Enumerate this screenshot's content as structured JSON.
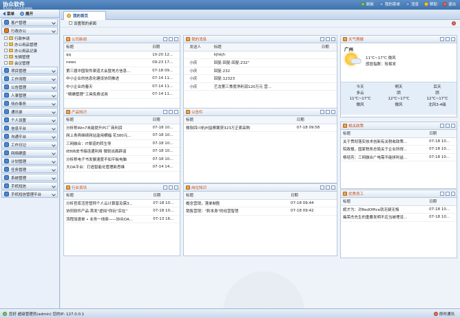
{
  "app": {
    "title": "协众软件",
    "subtitle": "专业OA 为企业提速增效"
  },
  "top_links": [
    "刷新",
    "我的菜单",
    "消息",
    "帮助",
    "退出"
  ],
  "sidebar": {
    "head": [
      "菜单",
      "展开"
    ],
    "menus": [
      {
        "label": "客户管理",
        "open": false
      },
      {
        "label": "行政办公",
        "open": true,
        "sub": [
          "行政申请",
          "办公用品管理",
          "办公用品记录",
          "车辆管理",
          "会议管理"
        ]
      },
      {
        "label": "项目管理"
      },
      {
        "label": "工作流程"
      },
      {
        "label": "公告管理"
      },
      {
        "label": "人事管理"
      },
      {
        "label": "待办事务"
      },
      {
        "label": "通讯录"
      },
      {
        "label": "个人设置"
      },
      {
        "label": "信息平台"
      },
      {
        "label": "沟通平台"
      },
      {
        "label": "工作日记"
      },
      {
        "label": "网络硬盘"
      },
      {
        "label": "计划管理"
      },
      {
        "label": "任务管理"
      },
      {
        "label": "系统管理"
      },
      {
        "label": "手机短信"
      },
      {
        "label": "手机短信管理平台"
      }
    ]
  },
  "main": {
    "tab": "我的首页",
    "toolbar_label": "设置我的桌面"
  },
  "panels": {
    "company_news": {
      "title": "公司新闻",
      "cols": [
        "标题",
        "日期"
      ],
      "rows": [
        [
          "qq",
          "10-20 12..."
        ],
        [
          "news",
          "09-23 17..."
        ],
        [
          "第三届中国软件渠道大会暨地方信息...",
          "07-18 09..."
        ],
        [
          "中小企业的信息化建设协同推进",
          "07-14 11..."
        ],
        [
          "中小企业的春天",
          "07-14 11..."
        ],
        [
          "“精确管理”工具免费试用",
          "07-14 11..."
        ]
      ]
    },
    "my_messages": {
      "title": "我的消息",
      "cols": [
        "",
        "发送人",
        "标题",
        "日期"
      ],
      "rows": [
        [
          "",
          "",
          "kjhkjh",
          ""
        ],
        [
          "",
          "小庆",
          "回复:回复:回复:232\"",
          ""
        ],
        [
          "",
          "小庆",
          "回复:232",
          ""
        ],
        [
          "",
          "小庆",
          "回复:12323",
          ""
        ],
        [
          "",
          "小庆",
          "艺龙第三季度净利润120万元 营...",
          ""
        ]
      ]
    },
    "product_knowledge": {
      "title": "产品知识",
      "cols": [
        "标题",
        "日期"
      ],
      "rows": [
        [
          "分析称Win7未能提升PC厂商利润",
          "07-18 10..."
        ],
        [
          "网上贵宾继续网站滥用横幅 花380元...",
          "07-18 10..."
        ],
        [
          "三网融合：IT渠道的转生导",
          "07-18 10..."
        ],
        [
          "IE8自皮书接连遭利用 微软出面辟谣",
          "07-18 10..."
        ],
        [
          "分析称电子书发展速度不如平板电脑",
          "07-18 10..."
        ],
        [
          "大OA平台：打造智能化管理新思维",
          "07-14 14..."
        ]
      ]
    },
    "bulletin": {
      "title": "公告栏",
      "cols": [
        "标题",
        "日期"
      ],
      "rows": [
        [
          "微软四川杭州监察案获323万正索采购",
          "07-18 09:58"
        ]
      ]
    },
    "industry_news": {
      "title": "行业资讯",
      "cols": [
        "标题",
        "日期"
      ],
      "rows": [
        [
          "分析官库活官管称个人云计算普及需3...",
          "07-18 10..."
        ],
        [
          "协同软件产品 首发\"虚拟\"你玩\"实在\"",
          "07-18 10..."
        ],
        [
          "流程加速单 • 业务一线牵——协众OA...",
          "07-13 16..."
        ]
      ]
    },
    "sales_knowledge": {
      "title": "岗位知识",
      "cols": [
        "标题",
        "日期"
      ],
      "rows": [
        [
          "概念营销，落单制胜",
          "07-18 09:44"
        ],
        [
          "销售营销：\"刺本身\"的经营智慧",
          "07-18 09:42"
        ]
      ]
    },
    "weather": {
      "title": "天气预报",
      "city": "广州",
      "temp": "11℃~17℃",
      "wind": "微风",
      "comfort": "感冒指数：较易发",
      "days": [
        {
          "name": "今天",
          "cond": "多云",
          "temp": "11℃~17℃",
          "wind": "微风"
        },
        {
          "name": "明天",
          "cond": "阴",
          "temp": "12℃~17℃",
          "wind": "微风"
        },
        {
          "name": "后天",
          "cond": "阴",
          "temp": "12℃~17℃",
          "wind": "北风3-4级"
        }
      ]
    },
    "policy": {
      "title": "相关政策",
      "cols": [
        "标题",
        "日期"
      ],
      "rows": [
        [
          "关于贯彻落实技术创新有关税收政策...",
          "07-18 10..."
        ],
        [
          "院政报，国家税务总局关于企业所得...",
          "07-18 10..."
        ],
        [
          "杨培芳：三网融合广电需不能拼利益...",
          "07-18 10..."
        ]
      ]
    },
    "staff": {
      "title": "优秀员工",
      "cols": [
        "标题",
        "日期"
      ],
      "rows": [
        [
          "妮才为：对RedOffice就无疑无悔",
          "07-18 10..."
        ],
        [
          "雍荣杰先生的重要发明不应当被埋没...",
          "07-18 10..."
        ]
      ]
    }
  },
  "status": {
    "user": "您好  超级管理员(admin)  您的IP: 127.0.0.1",
    "right": "即时通讯"
  }
}
